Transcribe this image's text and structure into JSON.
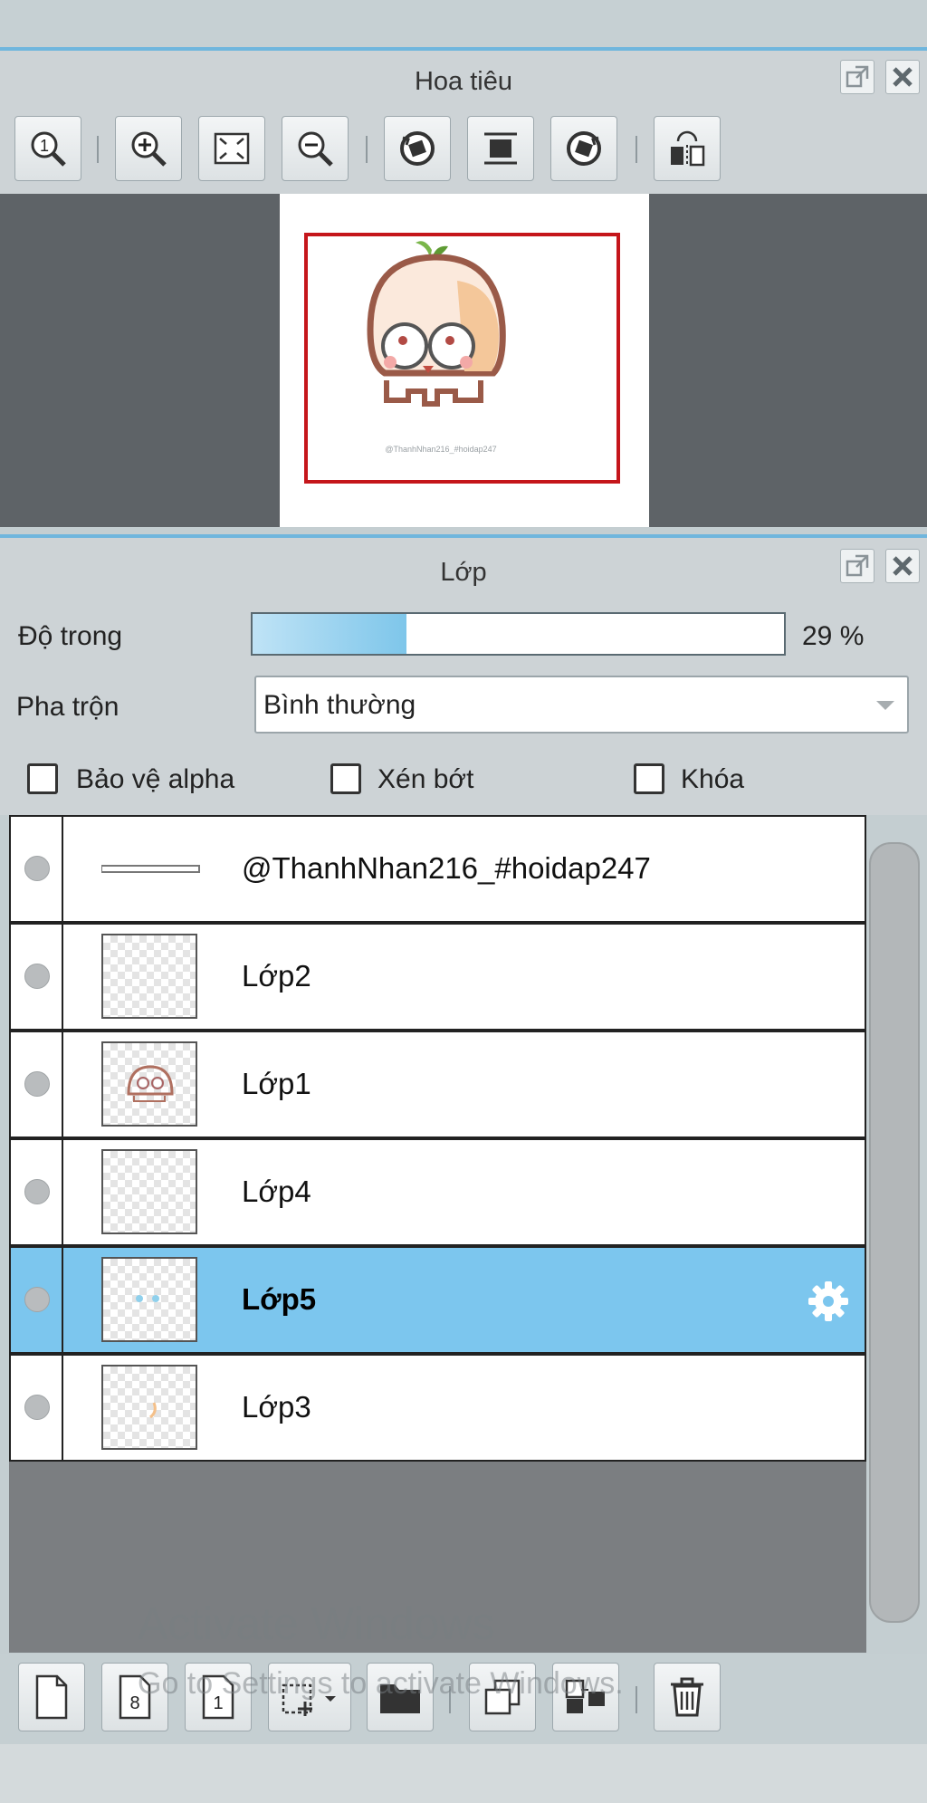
{
  "navigator": {
    "title": "Hoa tiêu",
    "tools": [
      "zoom-actual-size",
      "zoom-in",
      "fit-to-window",
      "zoom-out",
      "rotate-left",
      "fit-canvas",
      "rotate-right",
      "flip-horizontal"
    ],
    "preview_watermark": "@ThanhNhan216_#hoidap247"
  },
  "layers": {
    "title": "Lớp",
    "opacity_label": "Độ trong",
    "opacity_value": "29 %",
    "opacity_fraction": 0.29,
    "blend_label": "Pha trộn",
    "blend_value": "Bình thường",
    "protect_alpha_label": "Bảo vệ alpha",
    "clip_label": "Xén bớt",
    "lock_label": "Khóa",
    "items": [
      {
        "name": "@ThanhNhan216_#hoidap247",
        "selected": false,
        "thumb": "text-line"
      },
      {
        "name": "Lớp2",
        "selected": false,
        "thumb": "empty"
      },
      {
        "name": "Lớp1",
        "selected": false,
        "thumb": "character"
      },
      {
        "name": "Lớp4",
        "selected": false,
        "thumb": "empty"
      },
      {
        "name": "Lớp5",
        "selected": true,
        "thumb": "blue-dots"
      },
      {
        "name": "Lớp3",
        "selected": false,
        "thumb": "orange-mark"
      }
    ],
    "bottom_tools": [
      "new-layer",
      "new-8bit-layer",
      "new-1bit-layer",
      "add-layer-menu",
      "new-folder",
      "duplicate-layer",
      "merge-down",
      "delete-layer"
    ]
  },
  "watermark": {
    "line1": "Activate Windows",
    "line2": "Go to Settings to activate Windows."
  },
  "colors": {
    "selected_row": "#7cc6ee",
    "viewport_frame": "#c5161b",
    "panel_accent": "#6fb6dd"
  }
}
